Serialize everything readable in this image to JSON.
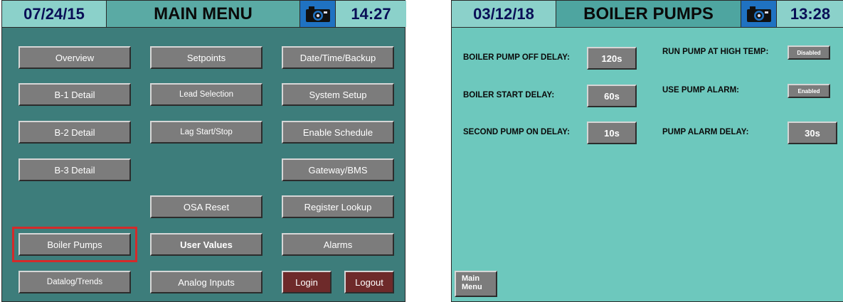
{
  "colors": {
    "panel1_bg": "#3d7d7b",
    "panel2_bg": "#6dc8bd",
    "button": "#7c7c7c",
    "logout": "#6e2a2a",
    "highlight": "#d42a2a",
    "camera": "#1f72c2"
  },
  "main_menu": {
    "date": "07/24/15",
    "title": "MAIN MENU",
    "camera_icon": "camera-icon",
    "time": "14:27",
    "buttons": {
      "overview": "Overview",
      "setpoints": "Setpoints",
      "date_time_backup": "Date/Time/Backup",
      "b1_detail": "B-1 Detail",
      "lead_selection": "Lead Selection",
      "system_setup": "System Setup",
      "b2_detail": "B-2 Detail",
      "lag_start_stop": "Lag Start/Stop",
      "enable_schedule": "Enable Schedule",
      "b3_detail": "B-3 Detail",
      "gateway_bms": "Gateway/BMS",
      "osa_reset": "OSA Reset",
      "register_lookup": "Register Lookup",
      "boiler_pumps": "Boiler Pumps",
      "user_values": "User Values",
      "alarms": "Alarms",
      "datalog_trends": "Datalog/Trends",
      "analog_inputs": "Analog Inputs",
      "login": "Login",
      "logout": "Logout"
    }
  },
  "boiler_pumps": {
    "date": "03/12/18",
    "title": "BOILER PUMPS",
    "camera_icon": "camera-icon",
    "time": "13:28",
    "settings": {
      "pump_off_delay_label": "BOILER PUMP OFF DELAY:",
      "pump_off_delay_value": "120s",
      "start_delay_label": "BOILER START DELAY:",
      "start_delay_value": "60s",
      "second_pump_label": "SECOND PUMP ON DELAY:",
      "second_pump_value": "10s",
      "run_high_temp_label": "RUN PUMP AT HIGH TEMP:",
      "run_high_temp_value": "Disabled",
      "use_alarm_label": "USE PUMP ALARM:",
      "use_alarm_value": "Enabled",
      "alarm_delay_label": "PUMP ALARM DELAY:",
      "alarm_delay_value": "30s"
    },
    "main_menu_button_line1": "Main",
    "main_menu_button_line2": "Menu"
  }
}
